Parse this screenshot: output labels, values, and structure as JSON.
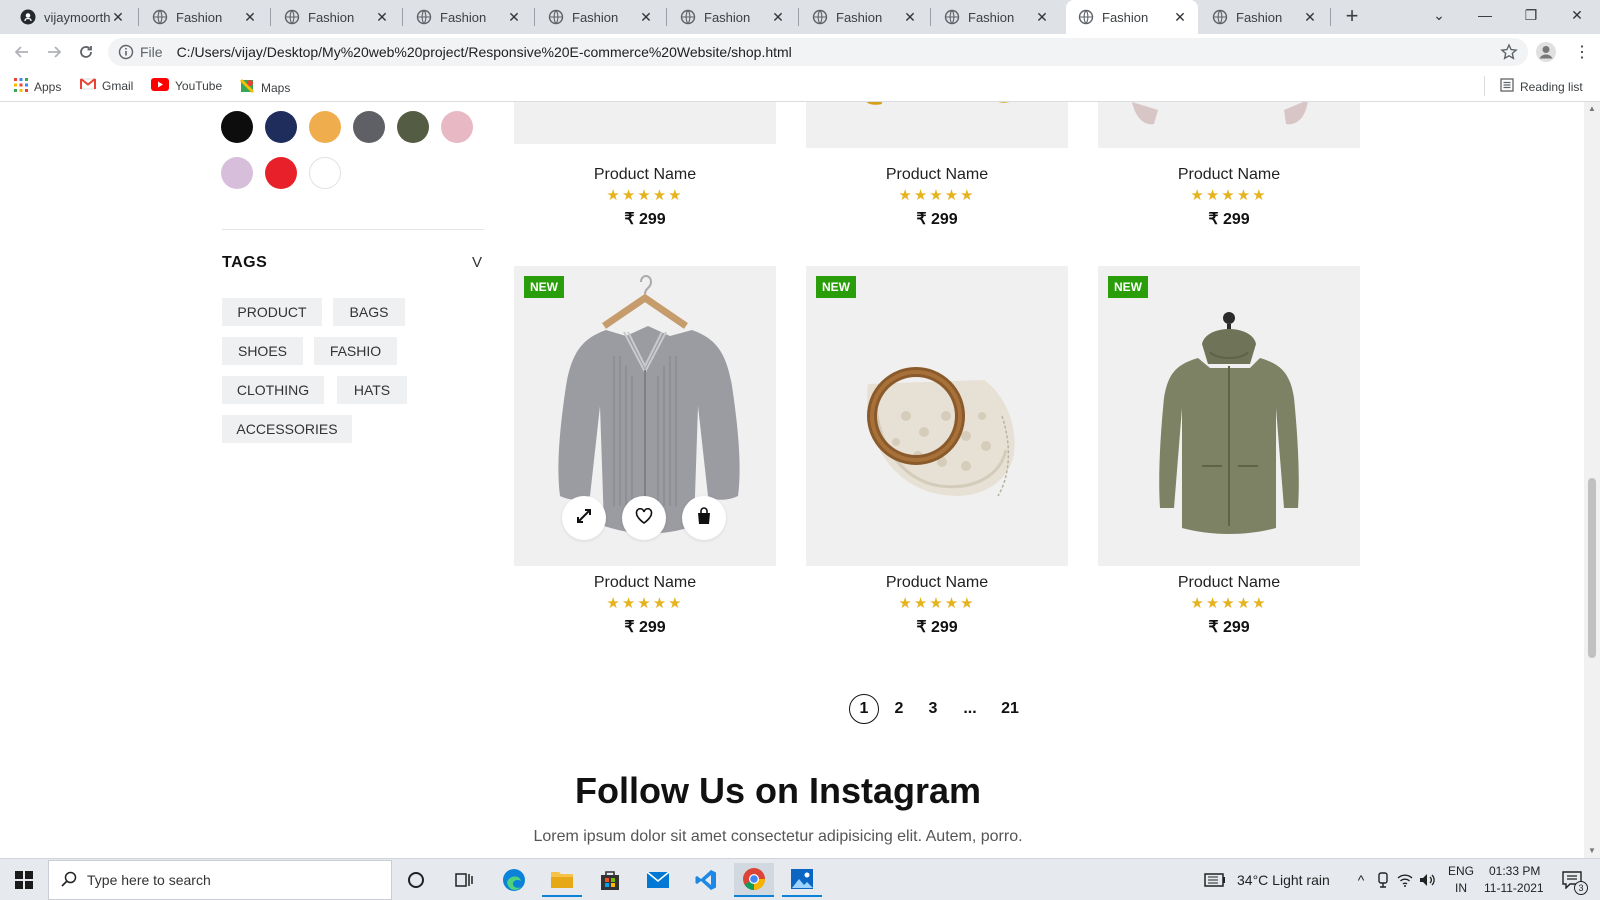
{
  "browser": {
    "tabs": [
      {
        "title": "vijaymoorthy",
        "icon": "github-icon",
        "active": false
      },
      {
        "title": "Fashion",
        "icon": "globe-icon",
        "active": false
      },
      {
        "title": "Fashion",
        "icon": "globe-icon",
        "active": false
      },
      {
        "title": "Fashion",
        "icon": "globe-icon",
        "active": false
      },
      {
        "title": "Fashion",
        "icon": "globe-icon",
        "active": false
      },
      {
        "title": "Fashion",
        "icon": "globe-icon",
        "active": false
      },
      {
        "title": "Fashion",
        "icon": "globe-icon",
        "active": false
      },
      {
        "title": "Fashion",
        "icon": "globe-icon",
        "active": false
      },
      {
        "title": "Fashion",
        "icon": "globe-icon",
        "active": true
      },
      {
        "title": "Fashion",
        "icon": "globe-icon",
        "active": false
      }
    ],
    "file_label": "File",
    "url": "C:/Users/vijay/Desktop/My%20web%20project/Responsive%20E-commerce%20Website/shop.html",
    "bookmarks": [
      {
        "label": "Apps",
        "icon": "apps-grid-icon"
      },
      {
        "label": "Gmail",
        "icon": "gmail-icon"
      },
      {
        "label": "YouTube",
        "icon": "youtube-icon"
      },
      {
        "label": "Maps",
        "icon": "maps-icon"
      }
    ],
    "reading_list": "Reading list"
  },
  "sidebar": {
    "colors": [
      "#0d0d0d",
      "#1f2d5c",
      "#f0ad4e",
      "#5f5f66",
      "#545c44",
      "#e8b9c4",
      "#d7bfdc",
      "#e8202a",
      "#ffffff"
    ],
    "tags_title": "TAGS",
    "tags_toggle": "V",
    "tags": [
      "PRODUCT",
      "BAGS",
      "SHOES",
      "FASHIO",
      "CLOTHING",
      "HATS",
      "ACCESSORIES"
    ]
  },
  "products_top": [
    {
      "name": "Product Name",
      "rating": 5,
      "price": "₹ 299"
    },
    {
      "name": "Product Name",
      "rating": 5,
      "price": "₹ 299"
    },
    {
      "name": "Product Name",
      "rating": 5,
      "price": "₹ 299"
    }
  ],
  "products_bottom": [
    {
      "badge": "NEW",
      "name": "Product Name",
      "rating": 5,
      "price": "₹ 299",
      "image": "grey-cardigan"
    },
    {
      "badge": "NEW",
      "name": "Product Name",
      "rating": 5,
      "price": "₹ 299",
      "image": "round-handle-bag"
    },
    {
      "badge": "NEW",
      "name": "Product Name",
      "rating": 5,
      "price": "₹ 299",
      "image": "olive-jacket"
    }
  ],
  "card_actions": [
    "expand-icon",
    "heart-icon",
    "bag-icon"
  ],
  "stars_text": "★★★★★",
  "pagination": {
    "pages": [
      "1",
      "2",
      "3",
      "...",
      "21"
    ],
    "current": "1"
  },
  "instagram": {
    "title": "Follow Us on Instagram",
    "subtitle": "Lorem ipsum dolor sit amet consectetur adipisicing elit. Autem, porro."
  },
  "taskbar": {
    "search_placeholder": "Type here to search",
    "weather": "34°C  Light rain",
    "lang_top": "ENG",
    "lang_bottom": "IN",
    "time": "01:33 PM",
    "date": "11-11-2021",
    "notifications": "3"
  }
}
